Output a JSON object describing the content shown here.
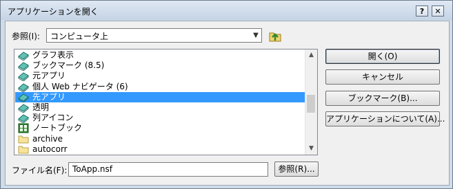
{
  "window": {
    "title": "アプリケーションを開く",
    "help_label": "?",
    "close_label": "✕"
  },
  "lookin": {
    "label": "参照(I):",
    "value": "コンピュータ上"
  },
  "list": {
    "items": [
      {
        "label": "グラフ表示",
        "icon": "book-icon"
      },
      {
        "label": "ブックマーク (8.5)",
        "icon": "book-icon"
      },
      {
        "label": "元アプリ",
        "icon": "book-icon"
      },
      {
        "label": "個人 Web ナビゲータ (6)",
        "icon": "book-icon"
      },
      {
        "label": "先アプリ",
        "icon": "book-icon",
        "selected": true
      },
      {
        "label": "透明",
        "icon": "book-icon"
      },
      {
        "label": "列アイコン",
        "icon": "book-icon"
      },
      {
        "label": "ノートブック",
        "icon": "notebook-icon"
      },
      {
        "label": "archive",
        "icon": "folder-icon"
      },
      {
        "label": "autocorr",
        "icon": "folder-icon"
      }
    ]
  },
  "buttons": {
    "open": "開く(O)",
    "cancel": "キャンセル",
    "bookmark": "ブックマーク(B)...",
    "about": "アプリケーションについて(A)..."
  },
  "filename": {
    "label": "ファイル名(F):",
    "value": "ToApp.nsf",
    "browse": "参照(R)..."
  },
  "colors": {
    "selection": "#3399ff",
    "titlebar": "#cfdbe8"
  }
}
